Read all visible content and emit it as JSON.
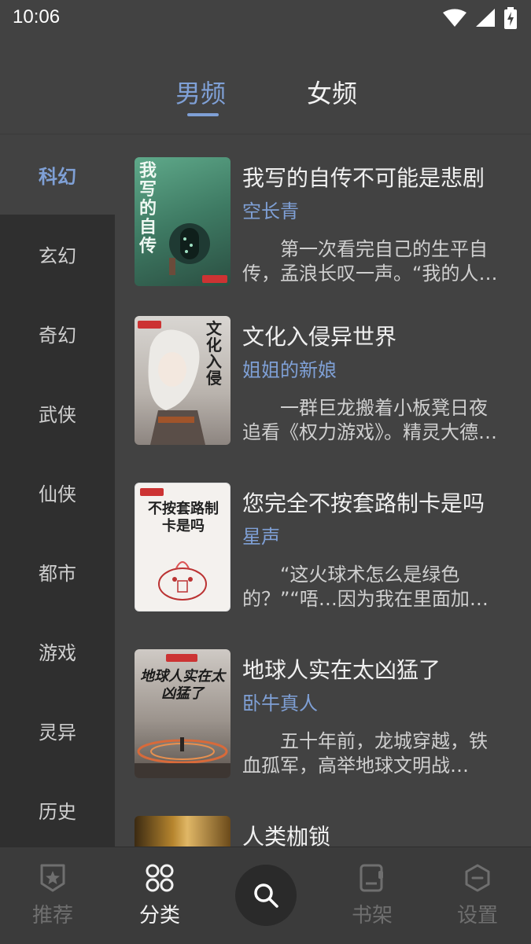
{
  "status_bar": {
    "time": "10:06"
  },
  "top_tabs": {
    "male": "男频",
    "female": "女频",
    "active": "male"
  },
  "categories": [
    "科幻",
    "玄幻",
    "奇幻",
    "武侠",
    "仙侠",
    "都市",
    "游戏",
    "灵异",
    "历史"
  ],
  "active_category": "科幻",
  "books": [
    {
      "title": "我写的自传不可能是悲剧",
      "author": "空长青",
      "description": "第一次看完自己的生平自传，孟浪长叹一声。“我的人生……”",
      "cover_title": "我写的自传"
    },
    {
      "title": "文化入侵异世界",
      "author": "姐姐的新娘",
      "description": "一群巨龙搬着小板凳日夜追看《权力游戏》。精灵大德鲁伊……",
      "cover_title": "文化入侵"
    },
    {
      "title": "您完全不按套路制卡是吗",
      "author": "星声",
      "description": "“这火球术怎么是绿色的？”“唔…因为我在里面加了毒气。”",
      "cover_title": "不按套路制卡是吗"
    },
    {
      "title": "地球人实在太凶猛了",
      "author": "卧牛真人",
      "description": "五十年前，龙城穿越，铁血孤军，高举地球文明战旗，……",
      "cover_title": "地球人实在太凶猛了"
    },
    {
      "title": "人类枷锁",
      "author": "",
      "description": "",
      "cover_title": ""
    }
  ],
  "bottom_nav": {
    "recommend": "推荐",
    "category": "分类",
    "bookshelf": "书架",
    "settings": "设置",
    "active": "category"
  }
}
